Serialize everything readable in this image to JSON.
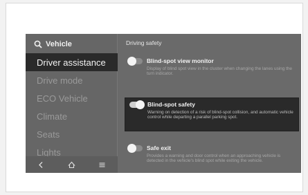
{
  "sidebar": {
    "search_label": "Vehicle",
    "items": [
      {
        "label": "Driver assistance",
        "active": true
      },
      {
        "label": "Drive mode",
        "active": false
      },
      {
        "label": "ECO Vehicle",
        "active": false
      },
      {
        "label": "Climate",
        "active": false
      },
      {
        "label": "Seats",
        "active": false
      },
      {
        "label": "Lights",
        "active": false
      }
    ],
    "nav": [
      "back-icon",
      "home-icon",
      "menu-icon"
    ]
  },
  "content": {
    "section_title": "Driving safety",
    "options": [
      {
        "title": "Blind-spot view monitor",
        "description": "Display of blind spot view in the cluster when changing the lanes using the turn indicator.",
        "enabled": false
      },
      {
        "title": "Blind-spot safety",
        "description": "Warning on detection of a risk of blind-spot collision, and automatic vehicle control while departing a parallel parking spot.",
        "enabled": true
      },
      {
        "title": "Safe exit",
        "description": "Provides a warning and door control when an approaching vehicle is detected in the vehicle's blind spot while exiting the vehicle.",
        "enabled": false
      }
    ]
  }
}
